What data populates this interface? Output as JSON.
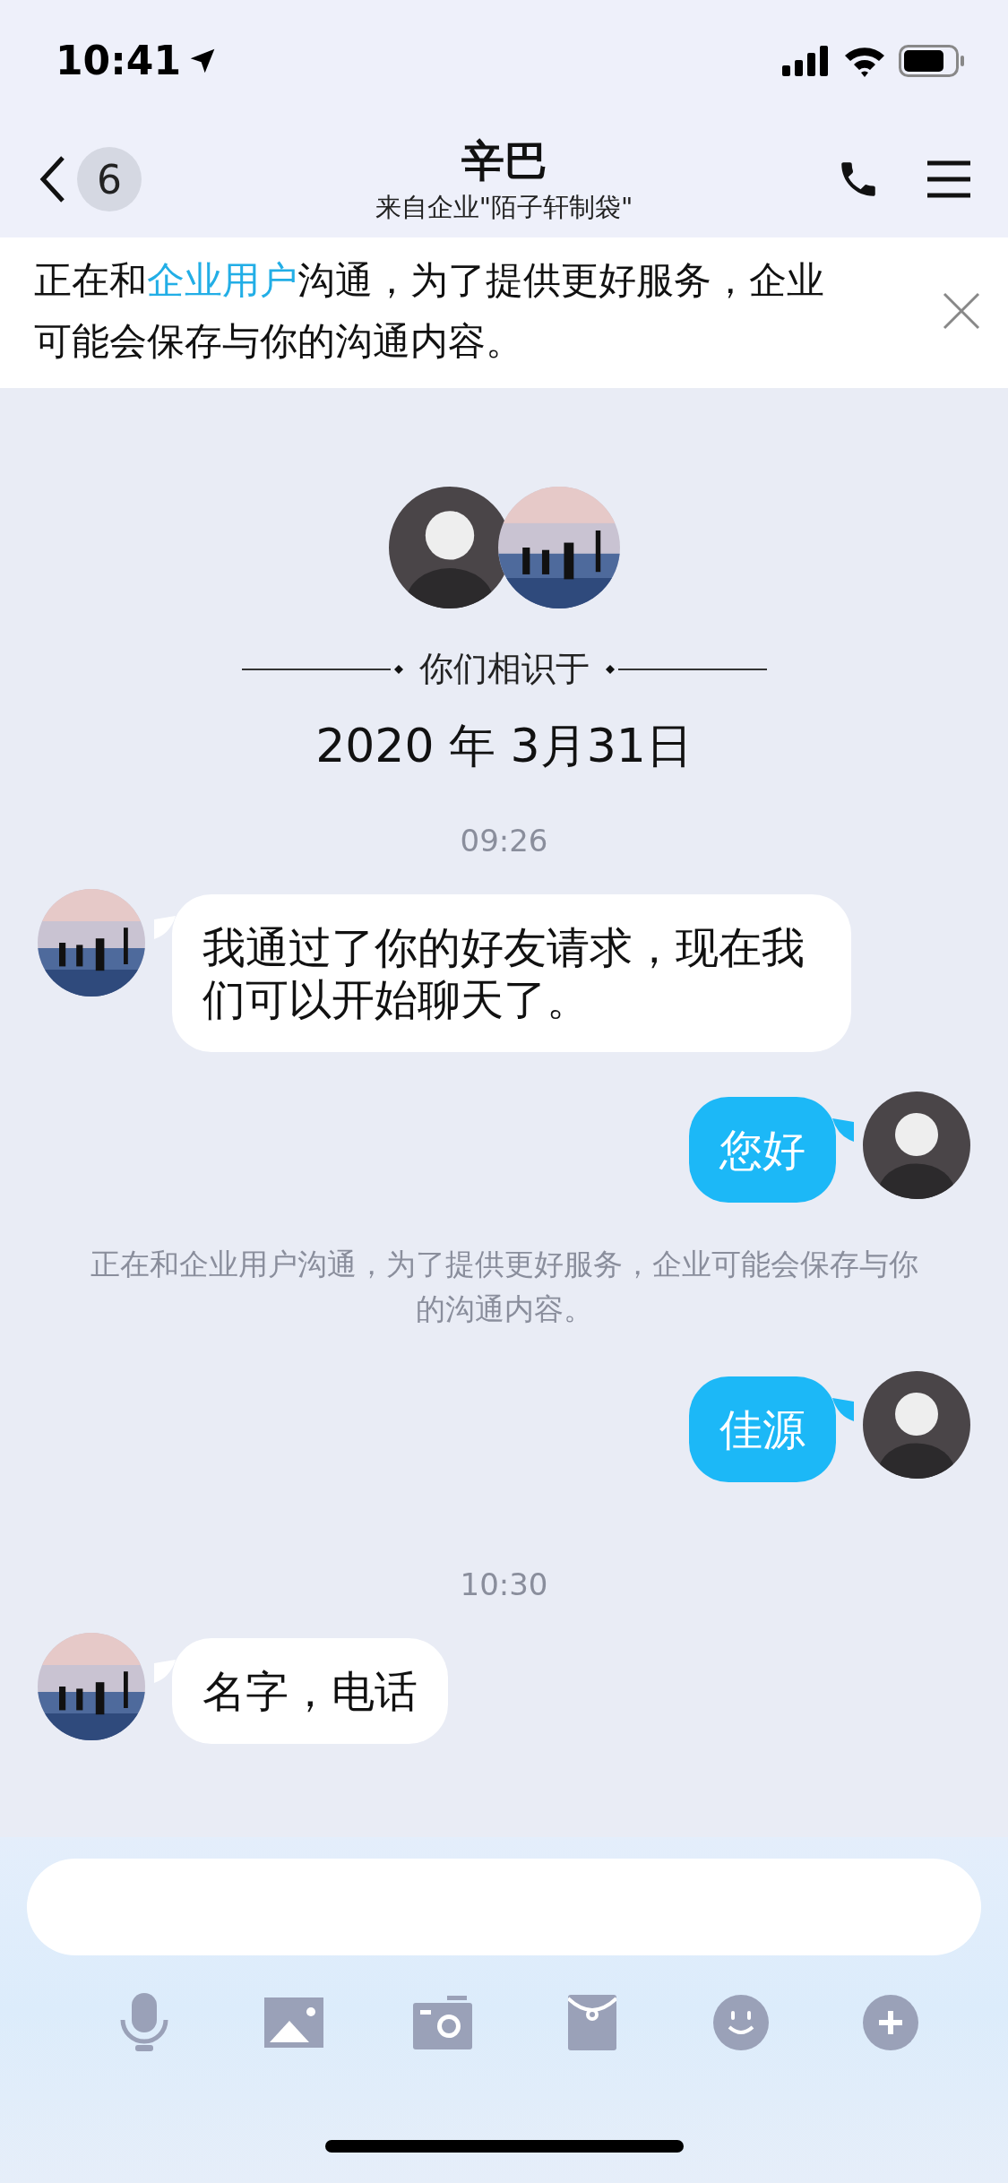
{
  "status_bar": {
    "time": "10:41"
  },
  "nav": {
    "back_count": "6",
    "title": "辛巴",
    "subtitle": "来自企业\"陌子轩制袋\""
  },
  "notice": {
    "prefix": "正在和",
    "link": "企业用户",
    "suffix": "沟通，为了提供更好服务，企业可能会保存与你的沟通内容。"
  },
  "intro": {
    "label": "你们相识于",
    "date": "2020 年 3月31日"
  },
  "messages": [
    {
      "kind": "time",
      "text": "09:26"
    },
    {
      "kind": "incoming",
      "text": "我通过了你的好友请求，现在我们可以开始聊天了。"
    },
    {
      "kind": "outgoing",
      "text": "您好"
    },
    {
      "kind": "system",
      "text": "正在和企业用户沟通，为了提供更好服务，企业可能会保存与你的沟通内容。"
    },
    {
      "kind": "outgoing",
      "text": "佳源"
    },
    {
      "kind": "time",
      "text": "10:30"
    },
    {
      "kind": "incoming",
      "text": "名字，电话"
    }
  ]
}
